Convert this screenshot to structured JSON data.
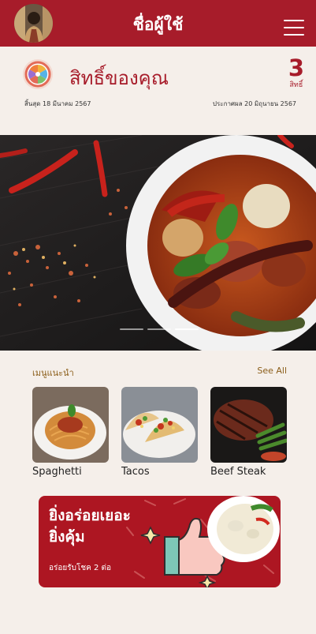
{
  "header": {
    "title": "ชื่อผู้ใช้",
    "avatar_icon": "user-avatar",
    "menu_icon": "hamburger-menu-icon"
  },
  "rights": {
    "icon": "lucky-wheel-icon",
    "title": "สิทธิ์ของคุณ",
    "count": "3",
    "count_unit": "สิทธิ์",
    "expiry": "สิ้นสุด 18 มีนาคม 2567",
    "announcement": "ประกาศผล 20 มิถุนายน 2567"
  },
  "hero": {
    "slide_count": 3,
    "active_slide": 3
  },
  "recommended": {
    "title": "เมนูแนะนำ",
    "see_all": "See All",
    "items": [
      {
        "label": "Spaghetti"
      },
      {
        "label": "Tacos"
      },
      {
        "label": "Beef Steak"
      }
    ]
  },
  "banner": {
    "line1": "ยิ่งอร่อยเยอะ",
    "line2": "ยิ่งคุ้ม",
    "sub": "อร่อยรับโชค 2 ต่อ"
  },
  "colors": {
    "brand": "#a71c2a",
    "background": "#f5efea",
    "accent_text": "#8b5e1a"
  }
}
